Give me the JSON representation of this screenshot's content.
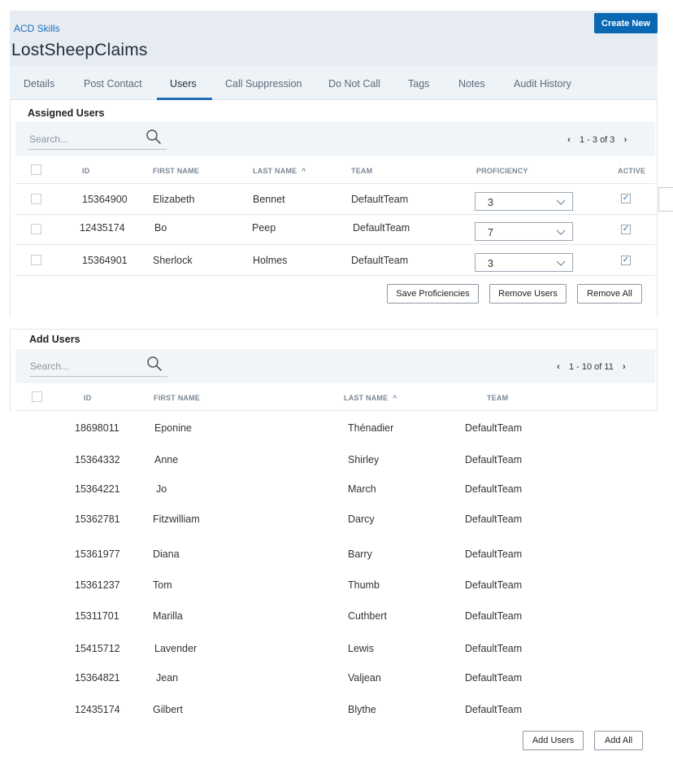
{
  "header": {
    "breadcrumb": "ACD Skills",
    "title": "LostSheepClaims",
    "create_button": "Create New"
  },
  "tabs": [
    {
      "label": "Details"
    },
    {
      "label": "Post Contact"
    },
    {
      "label": "Users",
      "active": true
    },
    {
      "label": "Call Suppression"
    },
    {
      "label": "Do Not Call"
    },
    {
      "label": "Tags"
    },
    {
      "label": "Notes"
    },
    {
      "label": "Audit History"
    }
  ],
  "assigned": {
    "title": "Assigned Users",
    "search_placeholder": "Search...",
    "pager": {
      "prev": "‹",
      "range": "1 - 3 of 3",
      "next": "›"
    },
    "columns": {
      "id": "ID",
      "first": "FIRST NAME",
      "last": "LAST NAME",
      "sort": "^",
      "team": "TEAM",
      "proficiency": "PROFICIENCY",
      "active": "ACTIVE"
    },
    "rows": [
      {
        "id": "15364900",
        "first": "Elizabeth",
        "last": "Bennet",
        "team": "DefaultTeam",
        "proficiency": "3",
        "active": "✓"
      },
      {
        "id": "12435174",
        "first": "Bo",
        "last": "Peep",
        "team": "DefaultTeam",
        "proficiency": "7",
        "active": "✓"
      },
      {
        "id": "15364901",
        "first": "Sherlock",
        "last": "Holmes",
        "team": "DefaultTeam",
        "proficiency": "3",
        "active": "✓"
      }
    ],
    "buttons": {
      "save": "Save Proficiencies",
      "remove": "Remove Users",
      "remove_all": "Remove All"
    }
  },
  "add": {
    "title": "Add Users",
    "search_placeholder": "Search...",
    "pager": {
      "prev": "‹",
      "range": "1 - 10 of 11",
      "next": "›"
    },
    "columns": {
      "id": "ID",
      "first": "FIRST NAME",
      "last": "LAST NAME",
      "sort": "^",
      "team": "TEAM"
    },
    "rows": [
      {
        "id": "18698011",
        "first": "Eponine",
        "last": "Thénadier",
        "team": "DefaultTeam"
      },
      {
        "id": "15364332",
        "first": "Anne",
        "last": "Shirley",
        "team": "DefaultTeam"
      },
      {
        "id": "15364221",
        "first": "Jo",
        "last": "March",
        "team": "DefaultTeam"
      },
      {
        "id": "15362781",
        "first": "Fitzwilliam",
        "last": "Darcy",
        "team": "DefaultTeam"
      },
      {
        "id": "15361977",
        "first": "Diana",
        "last": "Barry",
        "team": "DefaultTeam"
      },
      {
        "id": "15361237",
        "first": "Tom",
        "last": "Thumb",
        "team": "DefaultTeam"
      },
      {
        "id": "15311701",
        "first": "Marilla",
        "last": "Cuthbert",
        "team": "DefaultTeam"
      },
      {
        "id": "15415712",
        "first": "Lavender",
        "last": "Lewis",
        "team": "DefaultTeam"
      },
      {
        "id": "15364821",
        "first": "Jean",
        "last": "Valjean",
        "team": "DefaultTeam"
      },
      {
        "id": "12435174",
        "first": "Gilbert",
        "last": "Blythe",
        "team": "DefaultTeam"
      }
    ],
    "buttons": {
      "add": "Add Users",
      "add_all": "Add All"
    }
  },
  "icons": {
    "search": "search-icon",
    "chevron": "chevron-down-icon",
    "check": "check-icon"
  },
  "colors": {
    "accent": "#1e6fb8",
    "primary_button": "#0a68b3",
    "header_bg": "#e6ecf2"
  }
}
